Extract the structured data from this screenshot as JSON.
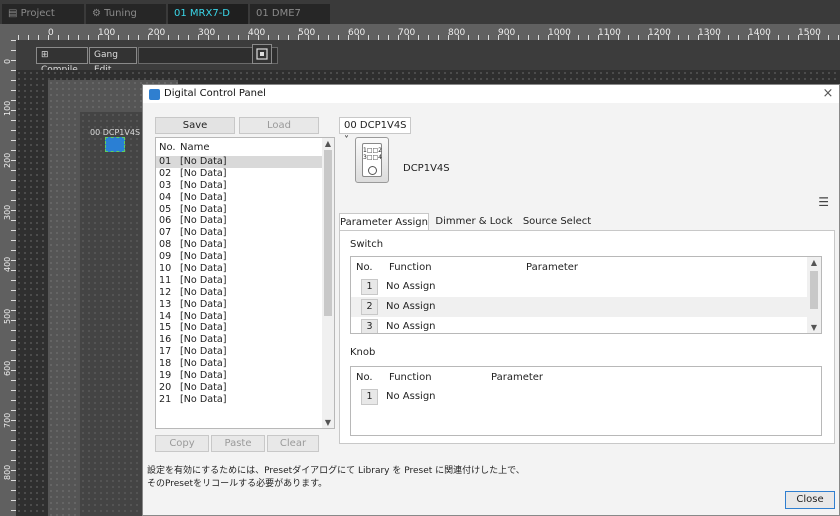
{
  "tabs": [
    {
      "label": "Project",
      "icon": "file-icon"
    },
    {
      "label": "Tuning",
      "icon": "tuning-icon"
    },
    {
      "label": "01 MRX7-D",
      "active": true
    },
    {
      "label": "01 DME7"
    }
  ],
  "ruler": {
    "labels": [
      "0",
      "100",
      "200",
      "300",
      "400",
      "500",
      "600",
      "700",
      "800",
      "900",
      "1000",
      "1100",
      "1200",
      "1300",
      "1400",
      "1500"
    ],
    "vlabels": [
      "0",
      "100",
      "200",
      "300",
      "400",
      "500",
      "600",
      "700",
      "800"
    ]
  },
  "toolbar": {
    "compile_label": "Compile",
    "gang_edit_label": "Gang Edit"
  },
  "canvas": {
    "device_label": "00 DCP1V4S"
  },
  "dialog": {
    "title": "Digital Control Panel",
    "save_label": "Save",
    "load_label": "Load",
    "preset_list": {
      "col_no": "No.",
      "col_name": "Name",
      "selected": "01",
      "rows": [
        {
          "no": "01",
          "name": "[No Data]"
        },
        {
          "no": "02",
          "name": "[No Data]"
        },
        {
          "no": "03",
          "name": "[No Data]"
        },
        {
          "no": "04",
          "name": "[No Data]"
        },
        {
          "no": "05",
          "name": "[No Data]"
        },
        {
          "no": "06",
          "name": "[No Data]"
        },
        {
          "no": "07",
          "name": "[No Data]"
        },
        {
          "no": "08",
          "name": "[No Data]"
        },
        {
          "no": "09",
          "name": "[No Data]"
        },
        {
          "no": "10",
          "name": "[No Data]"
        },
        {
          "no": "11",
          "name": "[No Data]"
        },
        {
          "no": "12",
          "name": "[No Data]"
        },
        {
          "no": "13",
          "name": "[No Data]"
        },
        {
          "no": "14",
          "name": "[No Data]"
        },
        {
          "no": "15",
          "name": "[No Data]"
        },
        {
          "no": "16",
          "name": "[No Data]"
        },
        {
          "no": "17",
          "name": "[No Data]"
        },
        {
          "no": "18",
          "name": "[No Data]"
        },
        {
          "no": "19",
          "name": "[No Data]"
        },
        {
          "no": "20",
          "name": "[No Data]"
        },
        {
          "no": "21",
          "name": "[No Data]"
        }
      ]
    },
    "copy_label": "Copy",
    "paste_label": "Paste",
    "clear_label": "Clear",
    "note_line1": "設定を有効にするためには、Presetダイアログにて Library を Preset に関連付けした上で、",
    "note_line2": "そのPresetをリコールする必要があります。",
    "device_select": "00 DCP1V4S",
    "device_thumb_text1": "1□□2",
    "device_thumb_text2": "3□□4",
    "device_model": "DCP1V4S",
    "tab_param": "Parameter Assign",
    "tab_dimmer": "Dimmer & Lock",
    "tab_source": "Source Select",
    "switch_label": "Switch",
    "knob_label": "Knob",
    "switch_cols": {
      "no": "No.",
      "function": "Function",
      "parameter": "Parameter"
    },
    "switch_rows": [
      {
        "no": "1",
        "function": "No Assign"
      },
      {
        "no": "2",
        "function": "No Assign"
      },
      {
        "no": "3",
        "function": "No Assign"
      }
    ],
    "knob_cols": {
      "no": "No.",
      "function": "Function",
      "parameter": "Parameter"
    },
    "knob_rows": [
      {
        "no": "1",
        "function": "No Assign"
      }
    ],
    "close_label": "Close"
  }
}
